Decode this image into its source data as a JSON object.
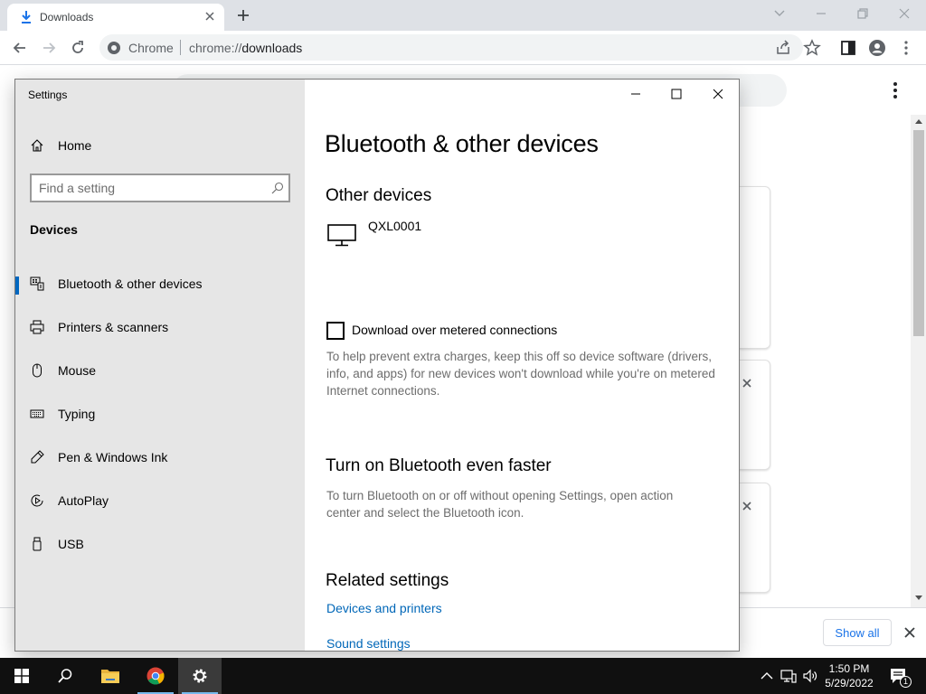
{
  "browser": {
    "tab": {
      "title": "Downloads"
    },
    "omnibox": {
      "site_chip": "Chrome",
      "url_scheme": "chrome://",
      "url_host": "downloads"
    }
  },
  "downloads": {
    "show_all_label": "Show all"
  },
  "settings": {
    "window_title": "Settings",
    "nav": {
      "home_label": "Home",
      "search_placeholder": "Find a setting",
      "section_title": "Devices",
      "items": [
        {
          "label": "Bluetooth & other devices",
          "icon": "bluetooth-devices-icon",
          "selected": true
        },
        {
          "label": "Printers & scanners",
          "icon": "printer-icon",
          "selected": false
        },
        {
          "label": "Mouse",
          "icon": "mouse-icon",
          "selected": false
        },
        {
          "label": "Typing",
          "icon": "keyboard-icon",
          "selected": false
        },
        {
          "label": "Pen & Windows Ink",
          "icon": "pen-icon",
          "selected": false
        },
        {
          "label": "AutoPlay",
          "icon": "autoplay-icon",
          "selected": false
        },
        {
          "label": "USB",
          "icon": "usb-icon",
          "selected": false
        }
      ]
    },
    "main": {
      "heading": "Bluetooth & other devices",
      "other_devices": {
        "title": "Other devices",
        "devices": [
          {
            "name": "QXL0001",
            "icon": "monitor-icon"
          }
        ]
      },
      "metered": {
        "checkbox_label": "Download over metered connections",
        "checked": false,
        "description": "To help prevent extra charges, keep this off so device software (drivers, info, and apps) for new devices won't download while you're on metered Internet connections."
      },
      "bluetooth_faster": {
        "title": "Turn on Bluetooth even faster",
        "description": "To turn Bluetooth on or off without opening Settings, open action center and select the Bluetooth icon."
      },
      "related": {
        "title": "Related settings",
        "links": [
          "Devices and printers",
          "Sound settings"
        ]
      }
    }
  },
  "taskbar": {
    "time": "1:50 PM",
    "date": "5/29/2022",
    "notification_count": "1"
  },
  "colors": {
    "accent": "#0067c0",
    "link": "#0067b8",
    "taskbar": "#101010",
    "chrome_frame": "#dee1e6"
  }
}
